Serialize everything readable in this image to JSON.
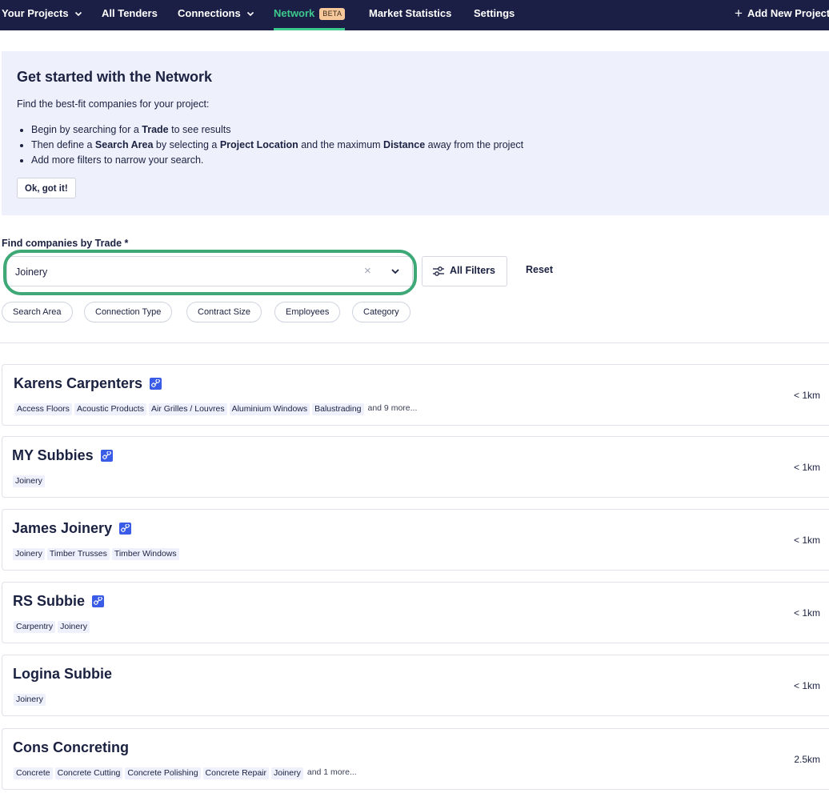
{
  "nav": {
    "your_projects": "Your Projects",
    "all_tenders": "All Tenders",
    "connections": "Connections",
    "network": "Network",
    "beta_badge": "BETA",
    "market_statistics": "Market Statistics",
    "settings": "Settings",
    "add_new_project": "Add New Project",
    "active_color": "#3ec98e",
    "background_color": "#1b1f45"
  },
  "info": {
    "title": "Get started with the Network",
    "lead": "Find the best-fit companies for your project:",
    "bullet1": {
      "a": "Begin by searching for a ",
      "b": "Trade",
      "c": " to see results"
    },
    "bullet2": {
      "a": "Then define a ",
      "b": "Search Area",
      "c": " by selecting a ",
      "d": "Project Location",
      "e": " and the maximum ",
      "f": "Distance",
      "g": " away from the project"
    },
    "bullet3": "Add more filters to narrow your search.",
    "button": "Ok, got it!"
  },
  "search": {
    "label": "Find companies by Trade *",
    "value": "Joinery",
    "clear": "×",
    "all_filters": "All Filters",
    "reset": "Reset",
    "chips": [
      "Search Area",
      "Connection Type",
      "Contract Size",
      "Employees",
      "Category"
    ]
  },
  "results": [
    {
      "name": "Karens Carpenters",
      "connected": true,
      "tags": [
        "Access Floors",
        "Acoustic Products",
        "Air Grilles / Louvres",
        "Aluminium Windows",
        "Balustrading"
      ],
      "more": "and 9 more...",
      "distance": "< 1km"
    },
    {
      "name": "MY Subbies",
      "connected": true,
      "tags": [
        "Joinery"
      ],
      "more": "",
      "distance": "< 1km"
    },
    {
      "name": "James Joinery",
      "connected": true,
      "tags": [
        "Joinery",
        "Timber Trusses",
        "Timber Windows"
      ],
      "more": "",
      "distance": "< 1km"
    },
    {
      "name": "RS Subbie",
      "connected": true,
      "tags": [
        "Carpentry",
        "Joinery"
      ],
      "more": "",
      "distance": "< 1km"
    },
    {
      "name": "Logina Subbie",
      "connected": false,
      "tags": [
        "Joinery"
      ],
      "more": "",
      "distance": "< 1km"
    },
    {
      "name": "Cons Concreting",
      "connected": false,
      "tags": [
        "Concrete",
        "Concrete Cutting",
        "Concrete Polishing",
        "Concrete Repair",
        "Joinery"
      ],
      "more": "and 1 more...",
      "distance": "2.5km"
    }
  ]
}
